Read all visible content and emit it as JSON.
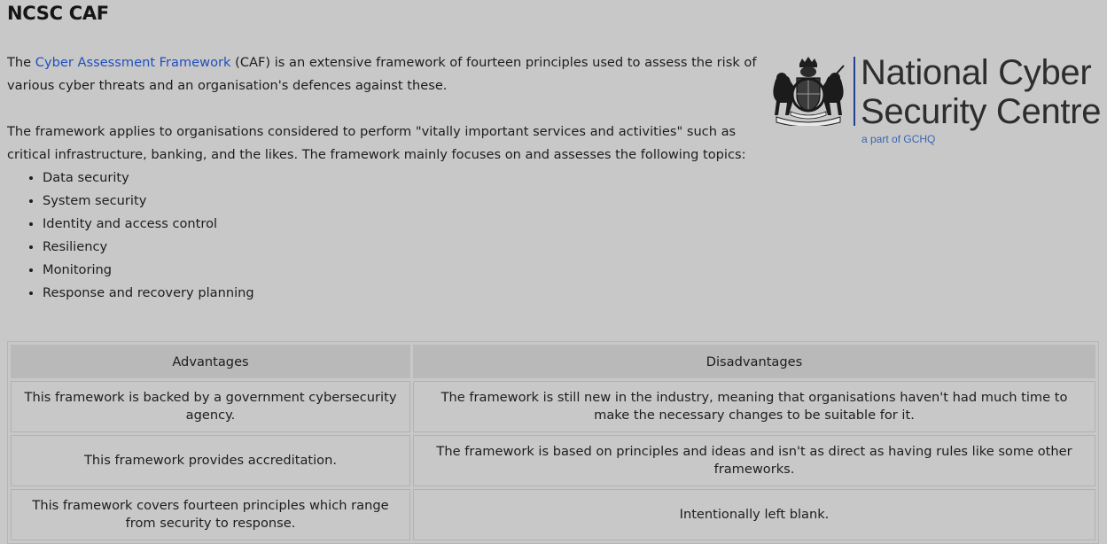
{
  "page": {
    "title": "NCSC CAF"
  },
  "intro": {
    "before_link": "The ",
    "link_text": "Cyber Assessment Framework",
    "after_link": " (CAF) is an extensive framework of fourteen principles used to assess the risk of various cyber threats and an organisation's defences against these."
  },
  "scope_paragraph": "The framework applies to organisations considered to perform \"vitally important services and activities\" such as critical infrastructure, banking, and the likes. The framework mainly focuses on and assesses the following topics:",
  "topics": [
    "Data security",
    "System security",
    "Identity and access control",
    "Resiliency",
    "Monitoring",
    "Response and recovery planning"
  ],
  "logo": {
    "line1": "National Cyber",
    "line2": "Security Centre",
    "subline": "a part of GCHQ",
    "accent_color": "#3a66b0",
    "icon": "royal-coat-of-arms"
  },
  "table": {
    "headers": [
      "Advantages",
      "Disadvantages"
    ],
    "rows": [
      [
        "This framework is backed by a government cybersecurity agency.",
        "The framework is still new in the industry, meaning that organisations haven't had much time to make the necessary changes to be suitable for it."
      ],
      [
        "This framework provides accreditation.",
        "The framework is based on principles and ideas and isn't as direct as having rules like some other frameworks."
      ],
      [
        "This framework covers fourteen principles which range from security to response.",
        "Intentionally left blank."
      ]
    ]
  },
  "colors": {
    "background": "#c8c8c8",
    "link": "#1f4fbf",
    "header_cell": "#b9b9b9"
  }
}
